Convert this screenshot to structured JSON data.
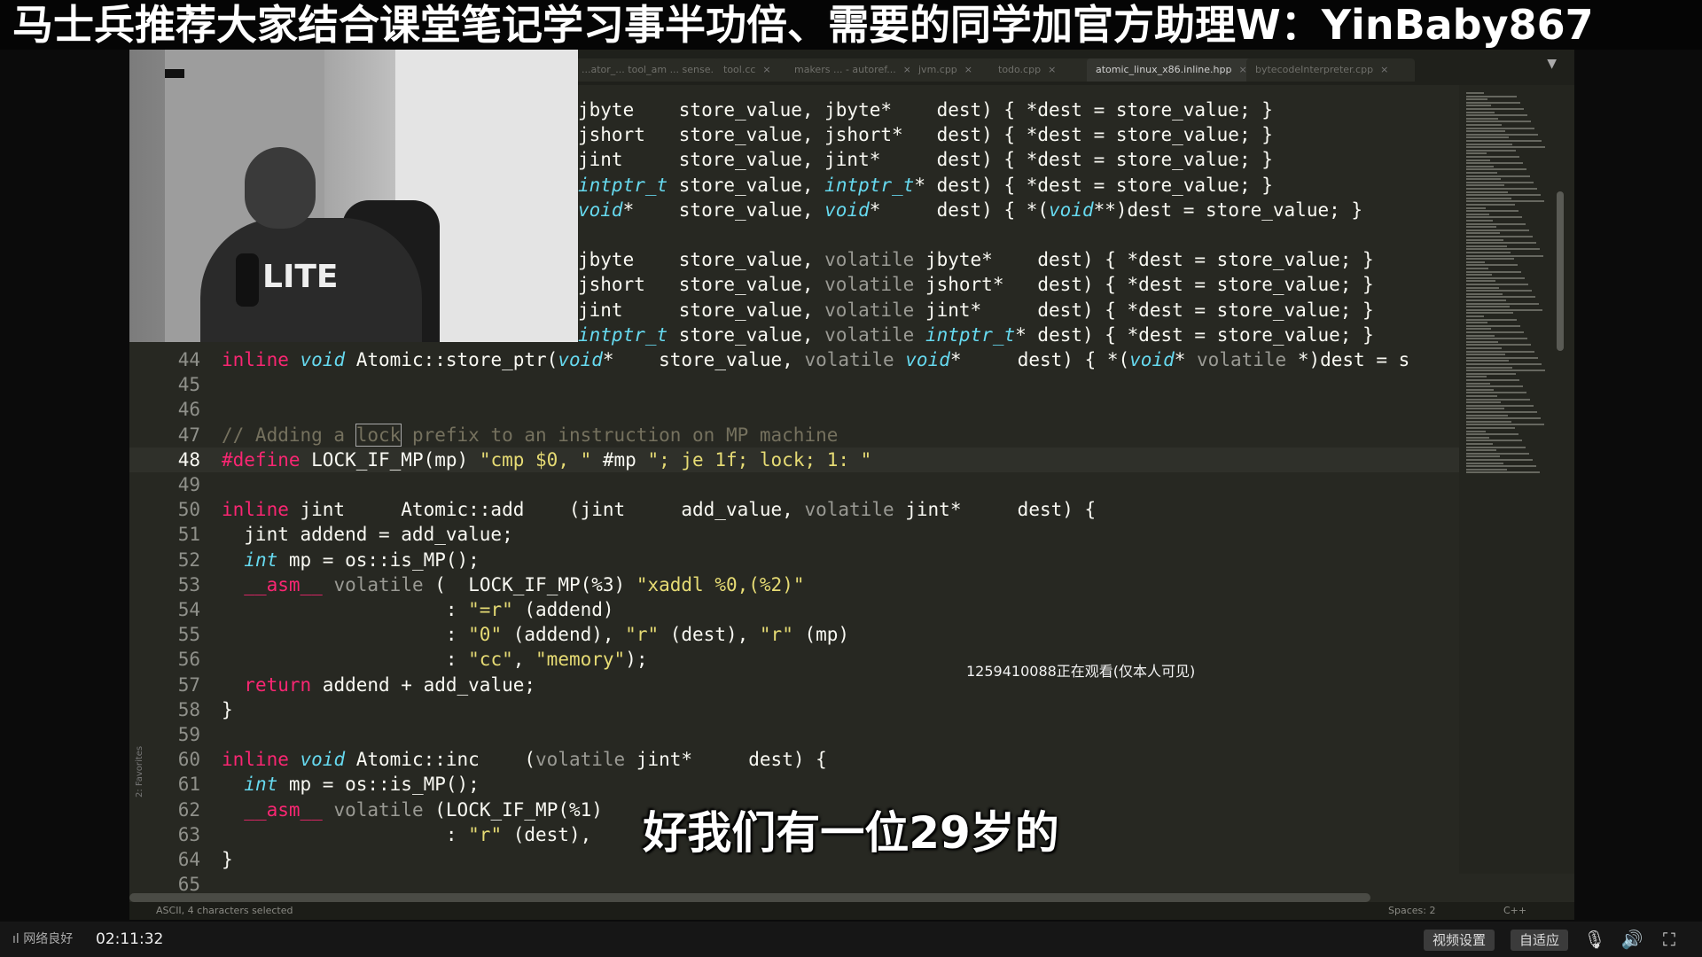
{
  "banner": {
    "text": "马士兵推荐大家结合课堂笔记学习事半功倍、需要的同学加官方助理W：YinBaby867"
  },
  "editor": {
    "tabs": [
      {
        "label": "...ator_... tool_am ... sense..."
      },
      {
        "label": "tool.cc"
      },
      {
        "label": "makers ... - autoref..."
      },
      {
        "label": "jvm.cpp"
      },
      {
        "label": "todo.cpp"
      },
      {
        "label": "atomic_linux_x86.inline.hpp",
        "active": true
      },
      {
        "label": "bytecodeInterpreter.cpp"
      }
    ],
    "code_lines": [
      {
        "n": "",
        "text": "jbyte    store_value, jbyte*    dest) { *dest = store_value; }"
      },
      {
        "n": "",
        "text": "jshort   store_value, jshort*   dest) { *dest = store_value; }"
      },
      {
        "n": "",
        "text": "jint     store_value, jint*     dest) { *dest = store_value; }"
      },
      {
        "n": "",
        "text": "intptr_t store_value, intptr_t* dest) { *dest = store_value; }"
      },
      {
        "n": "",
        "text": "void*    store_value, void*     dest) { *(void**)dest = store_value; }"
      },
      {
        "n": "",
        "text": ""
      },
      {
        "n": "",
        "text": "jbyte    store_value, volatile jbyte*    dest) { *dest = store_value; }"
      },
      {
        "n": "",
        "text": "jshort   store_value, volatile jshort*   dest) { *dest = store_value; }"
      },
      {
        "n": "",
        "text": "jint     store_value, volatile jint*     dest) { *dest = store_value; }"
      },
      {
        "n": "",
        "text": "intptr_t store_value, volatile intptr_t* dest) { *dest = store_value; }"
      },
      {
        "n": "44",
        "text": "inline void Atomic::store_ptr(void*    store_value, volatile void*     dest) { *(void* volatile *)dest = s"
      },
      {
        "n": "45",
        "text": ""
      },
      {
        "n": "46",
        "text": ""
      },
      {
        "n": "47",
        "text": "// Adding a lock prefix to an instruction on MP machine"
      },
      {
        "n": "48",
        "text": "#define LOCK_IF_MP(mp) \"cmp $0, \" #mp \"; je 1f; lock; 1: \""
      },
      {
        "n": "49",
        "text": ""
      },
      {
        "n": "50",
        "text": "inline jint     Atomic::add    (jint     add_value, volatile jint*     dest) {"
      },
      {
        "n": "51",
        "text": "  jint addend = add_value;"
      },
      {
        "n": "52",
        "text": "  int mp = os::is_MP();"
      },
      {
        "n": "53",
        "text": "  __asm__ volatile (  LOCK_IF_MP(%3) \"xaddl %0,(%2)\""
      },
      {
        "n": "54",
        "text": "                    : \"=r\" (addend)"
      },
      {
        "n": "55",
        "text": "                    : \"0\" (addend), \"r\" (dest), \"r\" (mp)"
      },
      {
        "n": "56",
        "text": "                    : \"cc\", \"memory\");"
      },
      {
        "n": "57",
        "text": "  return addend + add_value;"
      },
      {
        "n": "58",
        "text": "}"
      },
      {
        "n": "59",
        "text": ""
      },
      {
        "n": "60",
        "text": "inline void Atomic::inc    (volatile jint*     dest) {"
      },
      {
        "n": "61",
        "text": "  int mp = os::is_MP();"
      },
      {
        "n": "62",
        "text": "  __asm__ volatile (LOCK_IF_MP(%1)"
      },
      {
        "n": "63",
        "text": "                    : \"r\" (dest),"
      },
      {
        "n": "64",
        "text": "}"
      },
      {
        "n": "65",
        "text": ""
      }
    ],
    "current_line": "48",
    "statusbar": {
      "left": "ASCII, 4 characters selected",
      "spaces": "Spaces: 2",
      "syntax": "C++"
    },
    "sidebar_label": "2: Favorites"
  },
  "overlay": {
    "viewer_text": "1259410088正在观看(仅本人可见)",
    "subtitle": "好我们有一位29岁的",
    "shirt_text": "LITE"
  },
  "player": {
    "network": "网络良好",
    "time": "02:11:32",
    "buttons": [
      "视频设置",
      "自适应"
    ],
    "icons": [
      "mic-icon",
      "volume-icon",
      "fullscreen-icon"
    ]
  },
  "colors": {
    "editor_bg": "#272822",
    "keyword": "#f92672",
    "type": "#66d9ef",
    "string": "#e6db74",
    "comment": "#75715e"
  }
}
